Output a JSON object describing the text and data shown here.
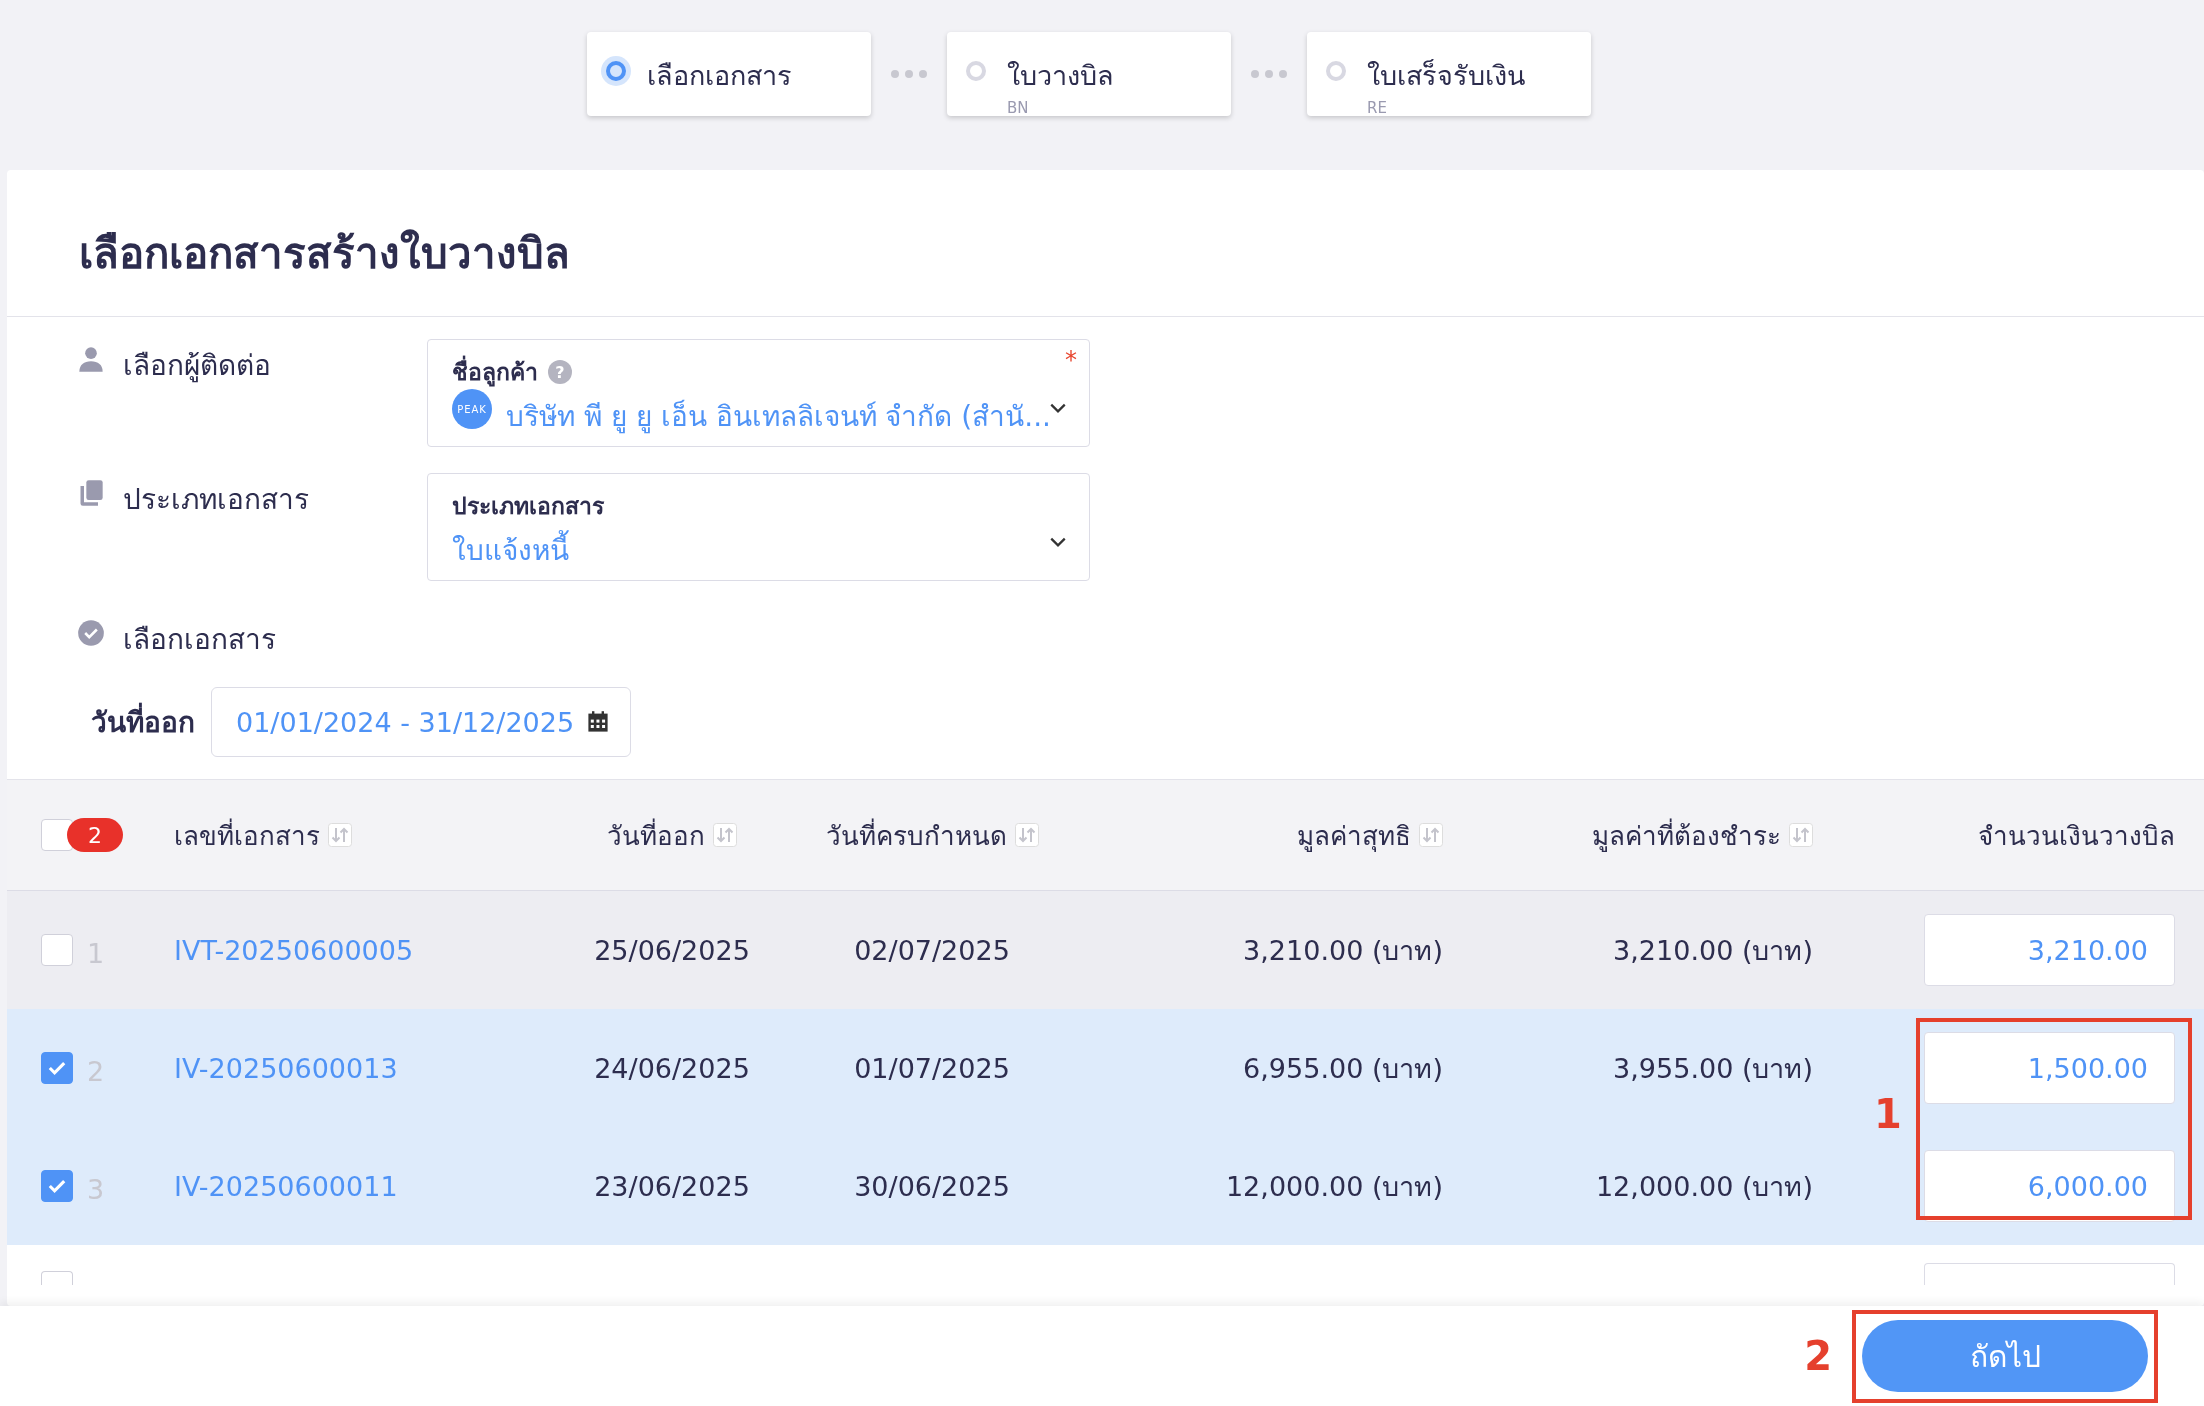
{
  "steps": [
    {
      "title": "เลือกเอกสาร",
      "selected": true
    },
    {
      "title": "ใบวางบิล",
      "code": "BN",
      "selected": false
    },
    {
      "title": "ใบเสร็จรับเงิน",
      "code": "RE",
      "selected": false
    }
  ],
  "page_title": "เลือกเอกสารสร้างใบวางบิล",
  "contact": {
    "label": "เลือกผู้ติดต่อ",
    "field_label": "ชื่อลูกค้า",
    "help_mark": "?",
    "required_mark": "*",
    "avatar": "PEAK",
    "value": "บริษัท พี ยู ยู เอ็น อินเทลลิเจนท์ จำกัด (สำนั..."
  },
  "doc_type": {
    "label": "ประเภทเอกสาร",
    "field_label": "ประเภทเอกสาร",
    "value": "ใบแจ้งหนี้"
  },
  "select_docs": {
    "label": "เลือกเอกสาร"
  },
  "date_filter": {
    "label": "วันที่ออก",
    "value": "01/01/2024 - 31/12/2025"
  },
  "table": {
    "all_checked": false,
    "selected_count": "2",
    "columns": [
      {
        "label": "เลขที่เอกสาร",
        "sortable": true
      },
      {
        "label": "วันที่ออก",
        "sortable": true
      },
      {
        "label": "วันที่ครบกำหนด",
        "sortable": true
      },
      {
        "label": "มูลค่าสุทธิ",
        "sortable": true
      },
      {
        "label": "มูลค่าที่ต้องชำระ",
        "sortable": true
      },
      {
        "label": "จำนวนเงินวางบิล",
        "sortable": false
      }
    ],
    "rows": [
      {
        "kind": "full",
        "number": "1",
        "doc_no": "IVT-20250600005",
        "issue_date": "25/06/2025",
        "due_date": "02/07/2025",
        "net": "3,210.00 (บาท)",
        "payable": "3,210.00 (บาท)",
        "amount": "3,210.00",
        "checked": false,
        "hovered": true
      },
      {
        "kind": "full",
        "number": "2",
        "doc_no": "IV-20250600013",
        "issue_date": "24/06/2025",
        "due_date": "01/07/2025",
        "net": "6,955.00 (บาท)",
        "payable": "3,955.00 (บาท)",
        "amount": "1,500.00",
        "checked": true,
        "hovered": false
      },
      {
        "kind": "full",
        "number": "3",
        "doc_no": "IV-20250600011",
        "issue_date": "23/06/2025",
        "due_date": "30/06/2025",
        "net": "12,000.00 (บาท)",
        "payable": "12,000.00 (บาท)",
        "amount": "6,000.00",
        "checked": true,
        "hovered": false
      },
      {
        "kind": "partial",
        "checked": false,
        "hovered": false
      }
    ]
  },
  "next_button": "ถัดไป",
  "annotations": {
    "amounts": "1",
    "next": "2"
  }
}
